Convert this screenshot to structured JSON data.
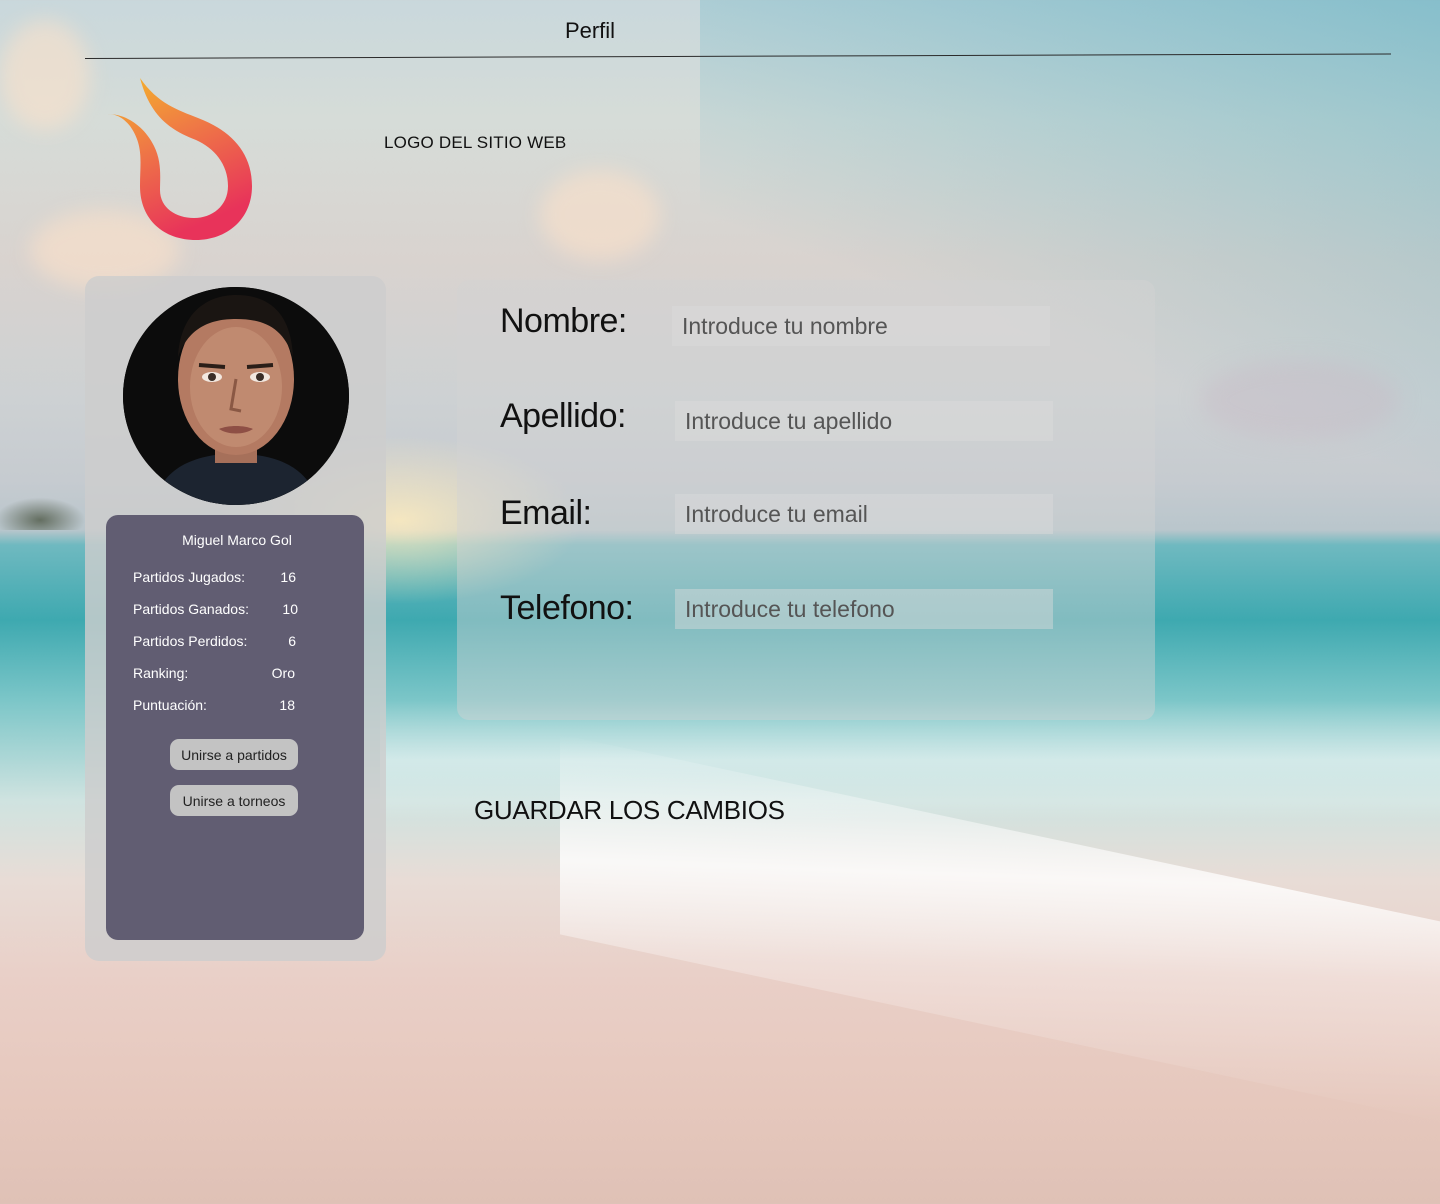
{
  "header": {
    "title": "Perfil"
  },
  "logo": {
    "icon": "flame-logo-icon",
    "caption": "LOGO DEL SITIO WEB",
    "colors": {
      "top": "#f5b62a",
      "mid": "#ef7a45",
      "bottom": "#e8335a"
    }
  },
  "profile": {
    "avatar_icon": "user-avatar",
    "name": "Miguel Marco Gol",
    "stats": [
      {
        "label": "Partidos Jugados:",
        "value": "16"
      },
      {
        "label": "Partidos Ganados:",
        "value": "10"
      },
      {
        "label": "Partidos Perdidos:",
        "value": "6"
      },
      {
        "label": "Ranking:",
        "value": "Oro"
      },
      {
        "label": "Puntuación:",
        "value": "18"
      }
    ],
    "buttons": {
      "join_matches": "Unirse a partidos",
      "join_tournaments": "Unirse a torneos"
    },
    "panel_color": "#615d72"
  },
  "form": {
    "fields": [
      {
        "label": "Nombre:",
        "placeholder": "Introduce tu nombre",
        "value": ""
      },
      {
        "label": "Apellido:",
        "placeholder": "Introduce tu apellido",
        "value": ""
      },
      {
        "label": "Email:",
        "placeholder": "Introduce tu email",
        "value": ""
      },
      {
        "label": "Telefono:",
        "placeholder": "Introduce tu telefono",
        "value": ""
      }
    ],
    "save_label": "GUARDAR LOS CAMBIOS"
  }
}
